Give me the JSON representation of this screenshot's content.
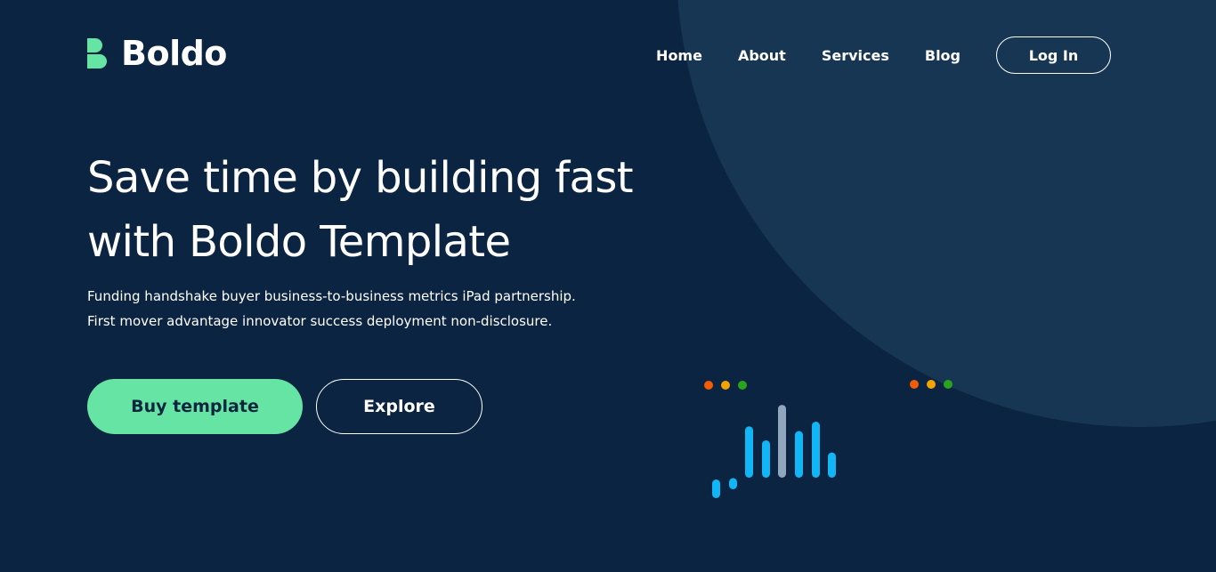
{
  "brand": {
    "name": "Boldo",
    "logo_color": "#65e4a3"
  },
  "nav": {
    "links": [
      "Home",
      "About",
      "Services",
      "Blog"
    ],
    "login_label": "Log In"
  },
  "hero": {
    "title_lines": [
      "Save time by building fast",
      "with Boldo Template"
    ],
    "description_lines": [
      "Funding handshake buyer business-to-business metrics iPad partnership.",
      "First mover advantage innovator success deployment non-disclosure."
    ],
    "buy_label": "Buy template",
    "explore_label": "Explore"
  },
  "colors": {
    "background": "#0b2441",
    "circle": "#173654",
    "accent": "#65e4a3",
    "bar": "#10b6f5",
    "bar_highlight": "#8fa6bd",
    "dot_red": "#f25c05",
    "dot_yellow": "#f2a405",
    "dot_green": "#2aa41c"
  },
  "decoration": {
    "bar_levels": [
      0.2,
      0.12,
      0.55,
      0.4,
      0.78,
      0.5,
      0.6,
      0.27
    ],
    "highlight_index": 4
  }
}
